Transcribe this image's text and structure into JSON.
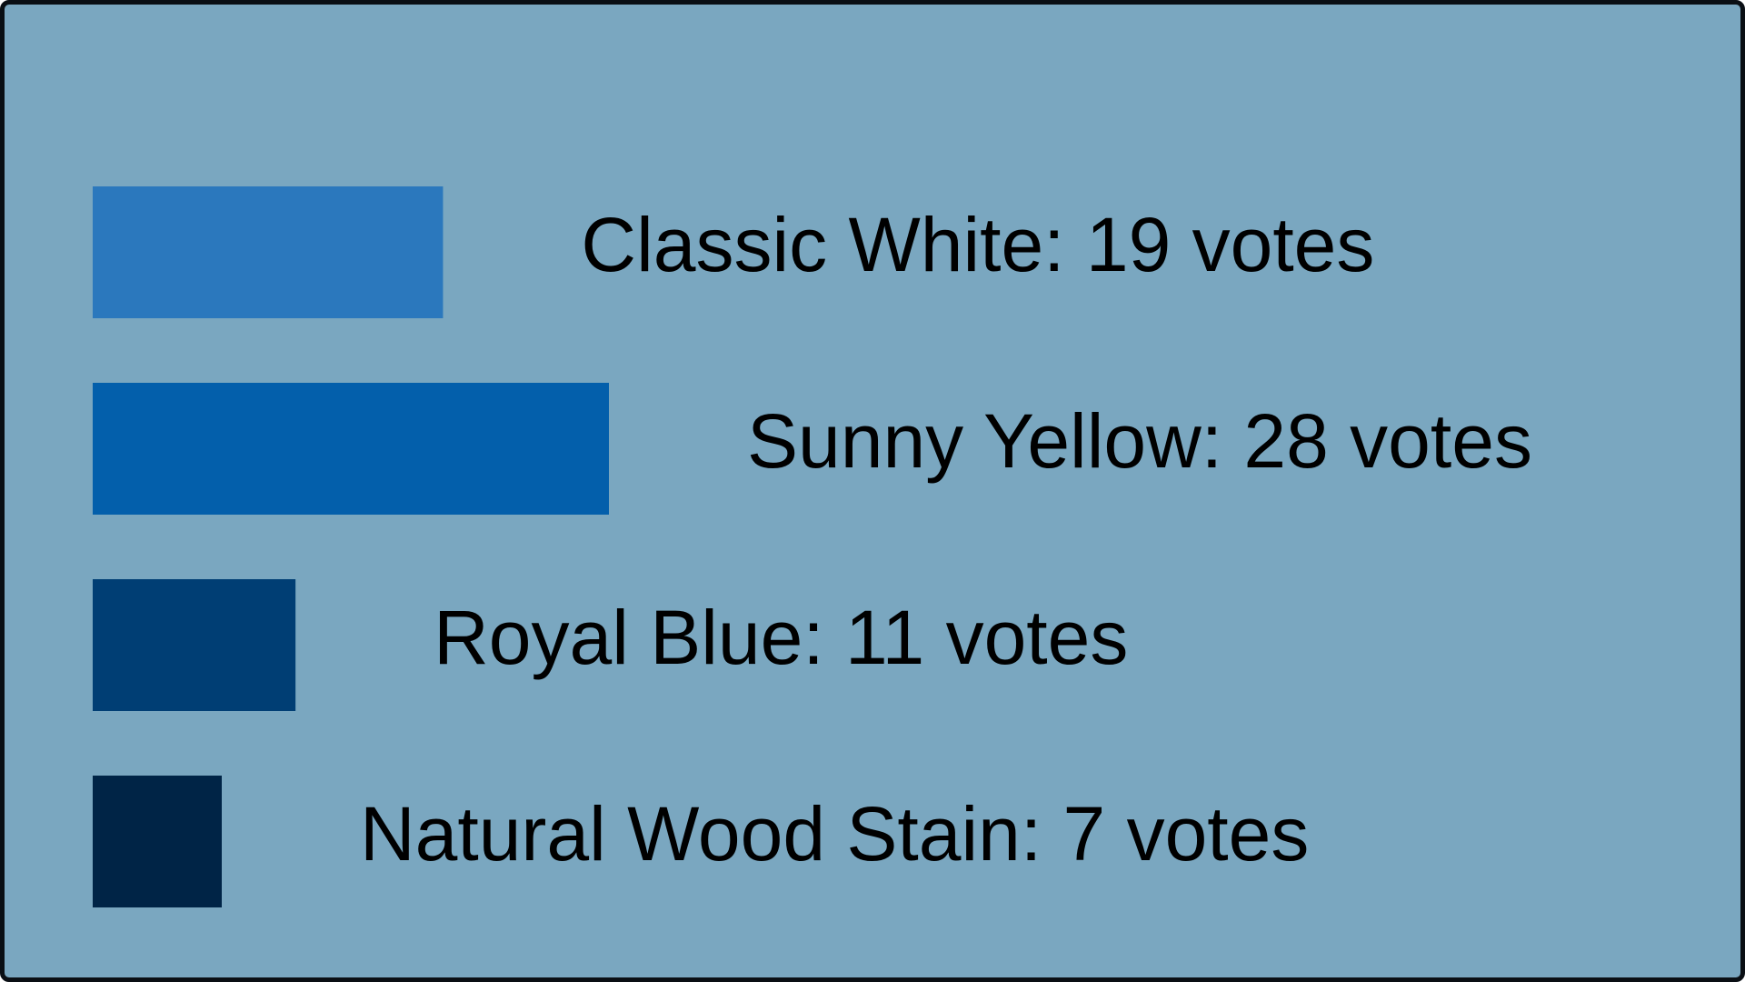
{
  "chart_data": {
    "type": "bar",
    "orientation": "horizontal",
    "categories": [
      "Classic White",
      "Sunny Yellow",
      "Royal Blue",
      "Natural Wood Stain"
    ],
    "values": [
      19,
      28,
      11,
      7
    ],
    "value_unit": "votes",
    "labels": [
      "Classic White: 19 votes",
      "Sunny Yellow: 28 votes",
      "Royal Blue: 11 votes",
      "Natural Wood Stain: 7 votes"
    ],
    "bar_colors": [
      "#2b78bd",
      "#035fab",
      "#003e74",
      "#002446"
    ],
    "title": "",
    "xlabel": "",
    "ylabel": "",
    "grid": false,
    "legend": "none"
  },
  "colors": {
    "background": "#7aa7c0",
    "border": "#0a0f14",
    "text": "#000000"
  }
}
